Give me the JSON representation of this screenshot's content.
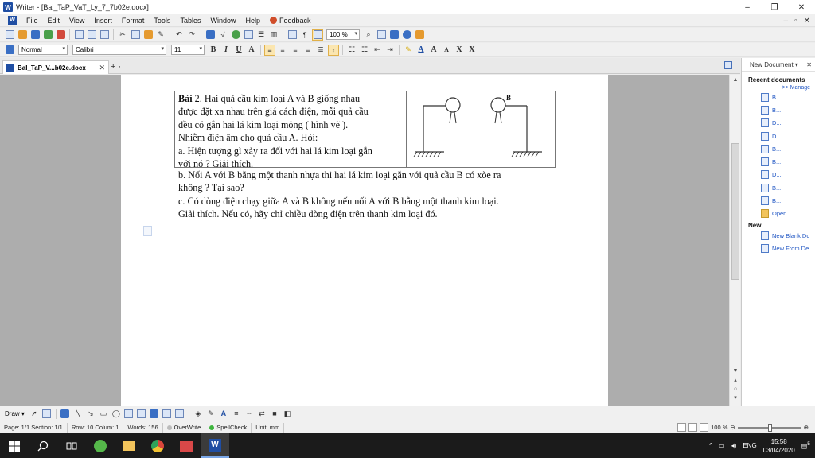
{
  "window": {
    "title": "Writer - [Bai_TaP_VaT_Ly_7_7b02e.docx]",
    "controls": {
      "minimize": "–",
      "maximize": "❐",
      "close": "✕"
    }
  },
  "menu": {
    "items": [
      "File",
      "Edit",
      "View",
      "Insert",
      "Format",
      "Tools",
      "Tables",
      "Window",
      "Help"
    ],
    "feedback": "Feedback",
    "right_controls": [
      "–",
      "▫",
      "✕"
    ]
  },
  "toolbar": {
    "zoom_value": "100 %",
    "style_value": "Normal",
    "font_value": "Calibri",
    "size_value": "11",
    "bold": "B",
    "italic": "I",
    "underline": "U",
    "font_color_letter": "A",
    "grow_font": "A",
    "shrink_font": "A",
    "superscript": "X",
    "subscript": "X"
  },
  "tab": {
    "doc_name": "BaI_TaP_V...b02e.docx",
    "close": "✕",
    "add": "+ ·"
  },
  "document": {
    "table_text": [
      "Bài 2.  Hai quả cầu kim loại A và B giống nhau",
      "được đặt xa nhau trên giá cách điện, mỗi quả cầu",
      "đều có gắn hai lá kim loại mỏng ( hình vẽ ).",
      "Nhiễm điện âm cho quả cầu A. Hỏi:",
      "a. Hiện tượng gì xảy ra đối với hai lá kim loại gắn",
      "với nó ? Giải thích."
    ],
    "bold_prefix": "Bài",
    "figure_label": "B",
    "body_lines": [
      "b. Nối A với B bằng một thanh nhựa thì hai lá kim loại gắn với quả cầu B có xòe ra",
      "không ? Tại sao?",
      "c. Có dòng điện chạy giữa A và B không nếu nối A với B bằng một thanh kim loại.",
      "Giải thích. Nếu có, hãy chỉ chiều dòng điện trên thanh kim loại đó."
    ]
  },
  "panel": {
    "title": "New Document ▾",
    "close": "✕",
    "recent_title": "Recent documents",
    "manage": ">> Manage",
    "recent_items": [
      "B...",
      "B...",
      "D...",
      "D...",
      "B...",
      "B...",
      "D...",
      "B...",
      "B..."
    ],
    "open": "Open...",
    "new_title": "New",
    "new_items": [
      "New Blank Dc",
      "New From De"
    ]
  },
  "drawbar": {
    "draw_label": "Draw ▾"
  },
  "status": {
    "page": "Page: 1/1 Section: 1/1",
    "row": "Row: 10 Colum: 1",
    "words": "Words: 156",
    "overwrite": "OverWrite",
    "spellcheck": "SpellCheck",
    "unit": "Unit: mm",
    "zoom": "100 %"
  },
  "taskbar": {
    "lang": "ENG",
    "time": "15:58",
    "date": "03/04/2020",
    "notification_count": "5"
  },
  "colors": {
    "accent": "#1f4ea3",
    "link": "#1f55c3",
    "page_bg": "#adadad"
  }
}
